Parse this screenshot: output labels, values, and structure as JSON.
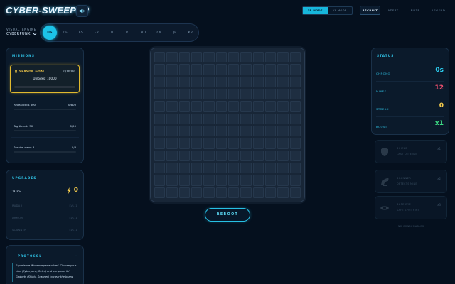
{
  "app": {
    "title": "CYBER-SWEEPER",
    "speaker_icon": "speaker-icon"
  },
  "visual": {
    "label": "VISUAL_ENGINE",
    "selected": "CYBERPUNK"
  },
  "languages": [
    "US",
    "DE",
    "ES",
    "FR",
    "IT",
    "PT",
    "RU",
    "CN",
    "JP",
    "KR"
  ],
  "active_language": "US",
  "modes": {
    "single": "1P MODE",
    "duel": "VS MODE",
    "active": "1P MODE"
  },
  "nav": {
    "items": [
      "RECRUIT",
      "ADEPT",
      "ELITE",
      "LEGEND"
    ],
    "active": "RECRUIT"
  },
  "missions": {
    "title": "MISSIONS",
    "season_goal": {
      "label": "SEASON GOAL",
      "count": "0/10000",
      "unlock": "Unlocks: 10000",
      "progress": 0
    },
    "items": [
      {
        "label": "Reveal cells 800",
        "count": "0/800",
        "progress": 0
      },
      {
        "label": "Tag threats 50",
        "count": "0/50",
        "progress": 0
      },
      {
        "label": "Survive wave 3",
        "count": "0/3",
        "progress": 0
      }
    ]
  },
  "upgrades": {
    "title": "UPGRADES",
    "chips_label": "CHIPS",
    "chips_value": "0",
    "items": [
      {
        "label": "RADAR",
        "level": "LVL 1"
      },
      {
        "label": "ARMOR",
        "level": "LVL 1"
      },
      {
        "label": "SCANNER",
        "level": "LVL 1"
      }
    ]
  },
  "protocol": {
    "title": "PROTOCOL",
    "collapse": "−",
    "lines": [
      "Experience Minesweeper evolved. Choose your",
      "vibe (Cyberpunk, Retro) and use powerful",
      "Gadgets (Shield, Scanner) to clear the board."
    ]
  },
  "board": {
    "rows": 12,
    "cols": 12
  },
  "reboot_label": "REBOOT",
  "status": {
    "title": "STATUS",
    "items": [
      {
        "label": "CHRONO",
        "value": "0s",
        "color": "#2ed3f5"
      },
      {
        "label": "MINES",
        "value": "12",
        "color": "#ef4f6e"
      },
      {
        "label": "STREAK",
        "value": "0",
        "color": "#f2c94c"
      },
      {
        "label": "BOOST",
        "value": "x1",
        "color": "#3ddc84"
      }
    ]
  },
  "abilities": [
    {
      "name": "SHIELD",
      "sub": "LAST DEFENSE",
      "count": "x1",
      "icon": "shield-icon"
    },
    {
      "name": "SCANNER",
      "sub": "DETECTS MINE",
      "count": "x2",
      "icon": "radar-icon"
    },
    {
      "name": "SAFE EYE",
      "sub": "SAFE SPOT HINT",
      "count": "x3",
      "icon": "eye-icon"
    }
  ],
  "abilities_note": "NO CONSUMABLES"
}
